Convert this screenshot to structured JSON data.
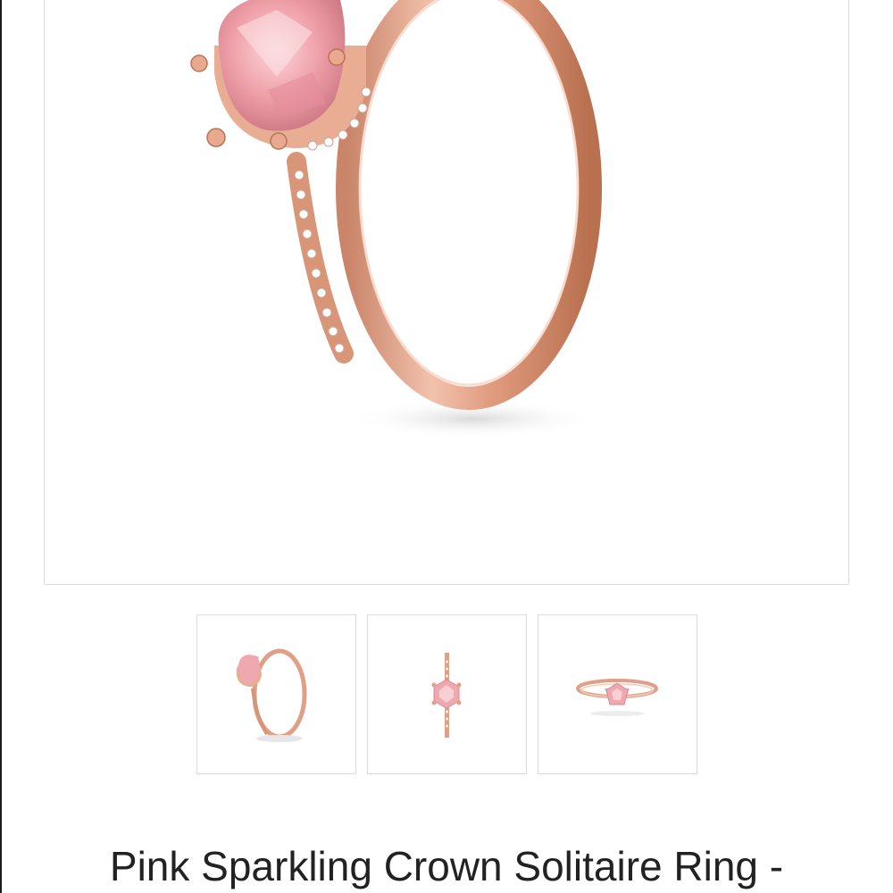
{
  "product": {
    "title": "Pink Sparkling Crown Solitaire Ring -"
  },
  "gallery": {
    "main_image": "ring-angled-view",
    "thumbnails": [
      {
        "view": "angled"
      },
      {
        "view": "top-down"
      },
      {
        "view": "front"
      }
    ]
  },
  "colors": {
    "rose_gold": "#e0a088",
    "rose_gold_dark": "#c27a5f",
    "stone_pink": "#f0a8b0",
    "border": "#dcdcdc",
    "text": "#222222"
  }
}
